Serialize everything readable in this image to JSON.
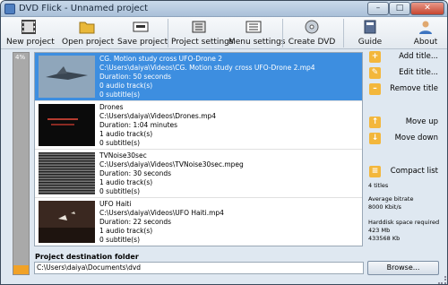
{
  "window": {
    "title": "DVD Flick - Unnamed project",
    "min": "–",
    "max": "□",
    "close": "✕"
  },
  "toolbar": {
    "new_project": "New project",
    "open_project": "Open project",
    "save_project": "Save project",
    "project_settings": "Project settings",
    "menu_settings": "Menu settings",
    "create_dvd": "Create DVD",
    "guide": "Guide",
    "about": "About"
  },
  "progress": {
    "label": "4%",
    "value": 0.04
  },
  "titles": [
    {
      "name": "CG. Motion study cross UFO-Drone 2",
      "path": "C:\\Users\\daiya\\Videos\\CG. Motion study cross UFO-Drone 2.mp4",
      "duration": "Duration: 50 seconds",
      "audio": "0 audio track(s)",
      "subs": "0 subtitle(s)",
      "selected": true
    },
    {
      "name": "Drones",
      "path": "C:\\Users\\daiya\\Videos\\Drones.mp4",
      "duration": "Duration: 1:04 minutes",
      "audio": "1 audio track(s)",
      "subs": "0 subtitle(s)",
      "selected": false
    },
    {
      "name": "TVNoise30sec",
      "path": "C:\\Users\\daiya\\Videos\\TVNoise30sec.mpeg",
      "duration": "Duration: 30 seconds",
      "audio": "1 audio track(s)",
      "subs": "0 subtitle(s)",
      "selected": false
    },
    {
      "name": "UFO Haiti",
      "path": "C:\\Users\\daiya\\Videos\\UFO Haiti.mp4",
      "duration": "Duration: 22 seconds",
      "audio": "1 audio track(s)",
      "subs": "0 subtitle(s)",
      "selected": false
    }
  ],
  "side": {
    "add_title": "Add title...",
    "edit_title": "Edit title...",
    "remove_title": "Remove title",
    "move_up": "Move up",
    "move_down": "Move down",
    "compact_list": "Compact list"
  },
  "info": {
    "titles_count": "4 titles",
    "avg_bitrate_label": "Average bitrate",
    "avg_bitrate": "8000 Kbit/s",
    "hdd_label": "Harddisk space required",
    "hdd_mb": "423 Mb",
    "hdd_kb": "433568 Kb"
  },
  "destination": {
    "label": "Project destination folder",
    "value": "C:\\Users\\daiya\\Documents\\dvd",
    "browse": "Browse..."
  }
}
